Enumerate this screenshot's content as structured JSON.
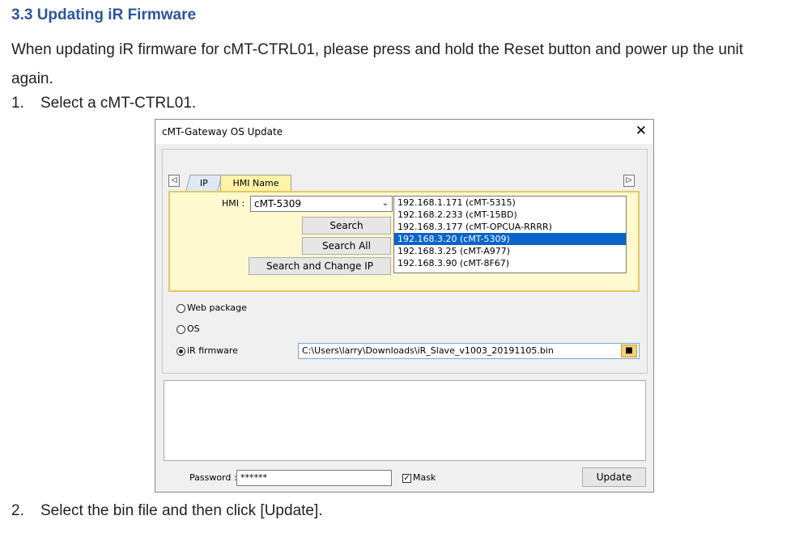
{
  "document": {
    "heading": "3.3 Updating iR Firmware",
    "paragraph": "When updating iR firmware for cMT-CTRL01, please press and hold the Reset button and power up the unit again.",
    "steps": [
      {
        "num": "1.",
        "text": "Select a cMT-CTRL01."
      },
      {
        "num": "2.",
        "text": "Select the bin file and then click [Update]."
      }
    ]
  },
  "dialog": {
    "title": "cMT-Gateway OS Update",
    "close_symbol": "✕",
    "tabs": [
      {
        "label": "IP"
      },
      {
        "label": "HMI Name"
      }
    ],
    "tab_arrow_left": "◁",
    "tab_arrow_right": "▷",
    "hmi_label": "HMI :",
    "hmi_value": "cMT-5309",
    "buttons": {
      "search": "Search",
      "search_all": "Search All",
      "search_change_ip": "Search and Change IP",
      "update": "Update"
    },
    "devices": [
      "192.168.1.171 (cMT-5315)",
      "192.168.2.233 (cMT-15BD)",
      "192.168.3.177 (cMT-OPCUA-RRRR)",
      "192.168.3.20 (cMT-5309)",
      "192.168.3.25 (cMT-A977)",
      "192.168.3.90 (cMT-8F67)"
    ],
    "selected_device_index": 3,
    "radios": [
      {
        "label": "Web package",
        "checked": false
      },
      {
        "label": "OS",
        "checked": false
      },
      {
        "label": "iR firmware",
        "checked": true
      }
    ],
    "file_path": "C:\\Users\\larry\\Downloads\\iR_Slave_v1003_20191105.bin",
    "password_label": "Password :",
    "password_value": "******",
    "mask_label": "Mask",
    "mask_checked": true,
    "colors": {
      "heading": "#2e5597",
      "selection": "#0a64c9",
      "gold_panel": "#fff9cf"
    }
  }
}
